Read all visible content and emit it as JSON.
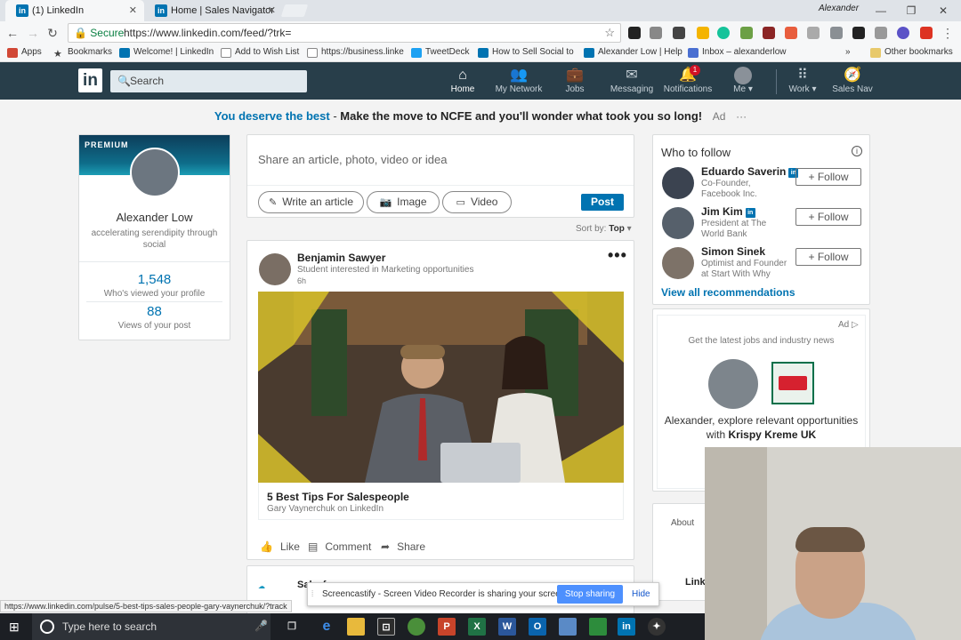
{
  "browser": {
    "tabs": [
      {
        "label": "(1) LinkedIn",
        "active": true
      },
      {
        "label": "Home | Sales Navigator",
        "active": false
      }
    ],
    "window_user": "Alexander",
    "secure_label": "Secure",
    "url": "https://www.linkedin.com/feed/?trk=",
    "bookmarks": [
      {
        "label": "Apps",
        "icon": "apps-grid-icon"
      },
      {
        "label": "Bookmarks",
        "icon": "star-icon"
      },
      {
        "label": "Welcome! | LinkedIn",
        "icon": "linkedin-icon"
      },
      {
        "label": "Add to Wish List",
        "icon": "page-icon"
      },
      {
        "label": "https://business.linke",
        "icon": "page-icon"
      },
      {
        "label": "TweetDeck",
        "icon": "twitter-icon"
      },
      {
        "label": "How to Sell Social to",
        "icon": "linkedin-icon"
      },
      {
        "label": "Alexander Low | Help",
        "icon": "linkedin-icon"
      },
      {
        "label": "Inbox – alexanderlow",
        "icon": "mail-icon"
      },
      {
        "label": "Other bookmarks",
        "icon": "folder-icon"
      }
    ],
    "overflow_chevron": "»"
  },
  "linkedin_nav": {
    "logo": "in",
    "search_placeholder": "Search",
    "items": [
      {
        "label": "Home",
        "icon": "home-icon",
        "active": true
      },
      {
        "label": "My Network",
        "icon": "network-icon",
        "active": false
      },
      {
        "label": "Jobs",
        "icon": "briefcase-icon",
        "active": false
      },
      {
        "label": "Messaging",
        "icon": "messaging-icon",
        "active": false
      },
      {
        "label": "Notifications",
        "icon": "bell-icon",
        "active": false,
        "badge": "1"
      },
      {
        "label": "Me",
        "icon": "avatar",
        "active": false,
        "has_caret": true
      },
      {
        "label": "Work",
        "icon": "grid-icon",
        "active": false,
        "has_caret": true
      },
      {
        "label": "Sales Nav",
        "icon": "compass-icon",
        "active": false
      }
    ]
  },
  "ad_banner": {
    "highlight": "You deserve the best",
    "message": "Make the move to NCFE and you'll wonder what took you so long!",
    "tag": "Ad",
    "more": "···"
  },
  "profile": {
    "premium_label": "PREMIUM",
    "name": "Alexander Low",
    "headline": "accelerating serendipity through social",
    "profile_views": "1,548",
    "profile_views_label": "Who's viewed your profile",
    "post_views": "88",
    "post_views_label": "Views of your post"
  },
  "share": {
    "placeholder": "Share an article, photo, video or idea",
    "write_article": "Write an article",
    "image": "Image",
    "video": "Video",
    "post": "Post"
  },
  "sort": {
    "label": "Sort by:",
    "value": "Top"
  },
  "post": {
    "author": "Benjamin Sawyer",
    "subtitle": "Student interested in Marketing opportunities",
    "time": "6h",
    "article_title": "5 Best Tips For Salespeople",
    "article_source": "Gary Vaynerchuk on LinkedIn",
    "actions": {
      "like": "Like",
      "comment": "Comment",
      "share": "Share"
    },
    "more": "•••"
  },
  "post2": {
    "author": "Salesforce.org"
  },
  "who_to_follow": {
    "title": "Who to follow",
    "people": [
      {
        "name": "Eduardo Saverin",
        "desc": "Co-Founder, Facebook Inc.",
        "button": "Follow",
        "in_badge": true
      },
      {
        "name": "Jim Kim",
        "desc": "President at The World Bank",
        "button": "Follow",
        "in_badge": true
      },
      {
        "name": "Simon Sinek",
        "desc": "Optimist and Founder at Start With Why",
        "button": "Follow",
        "in_badge": false
      }
    ],
    "view_all": "View all recommendations"
  },
  "side_ad": {
    "label": "Ad",
    "tagline": "Get the latest jobs and industry news",
    "message": "Alexander, explore relevant opportunities with",
    "company": "Krispy Kreme UK"
  },
  "footer_card": {
    "about": "About",
    "brand": "Linked"
  },
  "status_bar": {
    "url": "https://www.linkedin.com/pulse/5-best-tips-sales-people-gary-vaynerchuk/?track"
  },
  "screencastify": {
    "message": "Screencastify - Screen Video Recorder is sharing your screen.",
    "stop": "Stop sharing",
    "hide": "Hide"
  },
  "taskbar": {
    "search_placeholder": "Type here to search",
    "apps": [
      "task-view-icon",
      "edge-icon",
      "file-explorer-icon",
      "store-icon",
      "chrome-icon",
      "powerpoint-icon",
      "excel-icon",
      "word-icon",
      "outlook-icon",
      "photos-icon",
      "green-app-icon",
      "linkedin-icon",
      "gamepad-icon"
    ]
  },
  "colors": {
    "linkedin_blue": "#0073b1",
    "nav_bg": "#283e4a",
    "page_bg": "#f3f3f3"
  }
}
